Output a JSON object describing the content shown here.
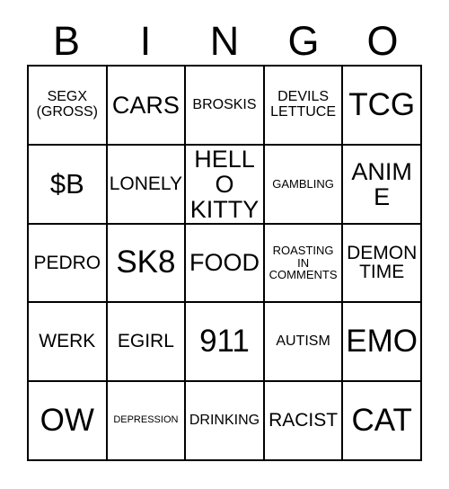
{
  "card": {
    "title_letters": [
      "B",
      "I",
      "N",
      "G",
      "O"
    ],
    "grid": [
      [
        {
          "text": "SEGX\n(GROSS)",
          "size": "xs"
        },
        {
          "text": "CARS",
          "size": "md"
        },
        {
          "text": "BROSKIS",
          "size": "xs"
        },
        {
          "text": "DEVILS\nLETTUCE",
          "size": "xs"
        },
        {
          "text": "TCG",
          "size": "xl"
        }
      ],
      [
        {
          "text": "$B",
          "size": "lg"
        },
        {
          "text": "LONELY",
          "size": "sm"
        },
        {
          "text": "HELLO\nKITTY",
          "size": "md"
        },
        {
          "text": "GAMBLING",
          "size": "xxs"
        },
        {
          "text": "ANIME",
          "size": "md"
        }
      ],
      [
        {
          "text": "PEDRO",
          "size": "sm"
        },
        {
          "text": "SK8",
          "size": "xl"
        },
        {
          "text": "FOOD",
          "size": "md"
        },
        {
          "text": "ROASTING\nIN\nCOMMENTS",
          "size": "xxs"
        },
        {
          "text": "DEMON\nTIME",
          "size": "sm"
        }
      ],
      [
        {
          "text": "WERK",
          "size": "sm"
        },
        {
          "text": "EGIRL",
          "size": "sm"
        },
        {
          "text": "911",
          "size": "xl"
        },
        {
          "text": "AUTISM",
          "size": "xs"
        },
        {
          "text": "EMO",
          "size": "xl"
        }
      ],
      [
        {
          "text": "OW",
          "size": "xl"
        },
        {
          "text": "DEPRESSION",
          "size": "tiny"
        },
        {
          "text": "DRINKING",
          "size": "xs"
        },
        {
          "text": "RACIST",
          "size": "sm"
        },
        {
          "text": "CAT",
          "size": "xl"
        }
      ]
    ],
    "colors": {
      "background": "#ffffff",
      "ink": "#000000",
      "grid_line": "#000000"
    }
  }
}
